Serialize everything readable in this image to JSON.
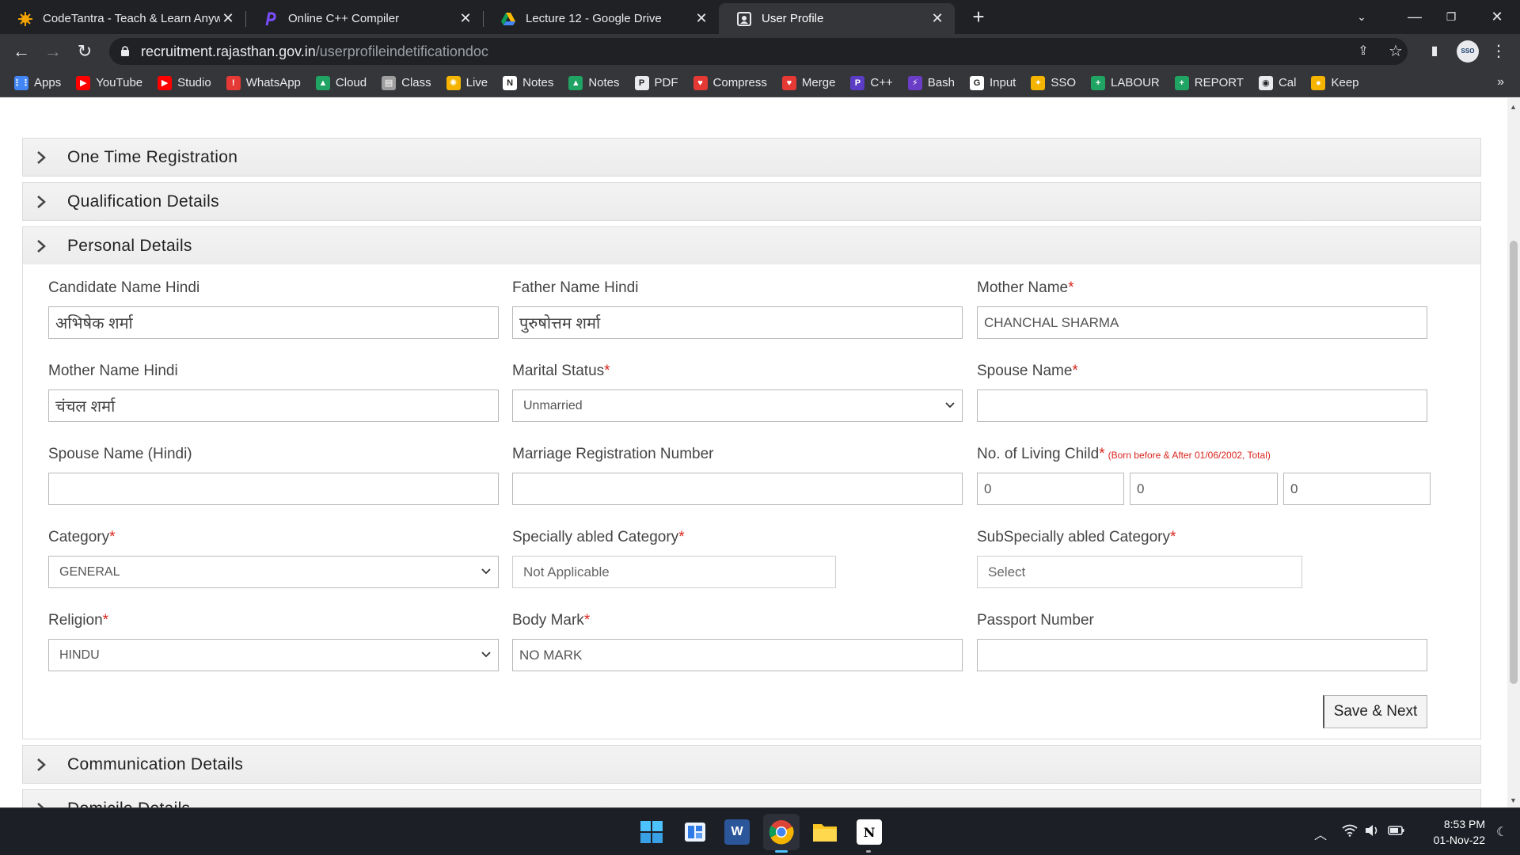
{
  "browser": {
    "tabs": [
      {
        "title": "CodeTantra - Teach & Learn Anyw",
        "icon": "codetantra-icon",
        "active": false
      },
      {
        "title": "Online C++ Compiler",
        "icon": "programiz-icon",
        "active": false
      },
      {
        "title": "Lecture 12 - Google Drive",
        "icon": "google-drive-icon",
        "active": false
      },
      {
        "title": "User Profile",
        "icon": "page-icon",
        "active": true
      }
    ],
    "url_host": "recruitment.rajasthan.gov.in",
    "url_path": "/userprofileindetificationdoc",
    "profile_badge": "SSO",
    "bookmarks": [
      {
        "label": "Apps",
        "icon": "apps-grid-icon",
        "color": "#4285f4"
      },
      {
        "label": "YouTube",
        "icon": "youtube-icon",
        "color": "#ff0000"
      },
      {
        "label": "Studio",
        "icon": "youtube-studio-icon",
        "color": "#ff0000"
      },
      {
        "label": "WhatsApp",
        "icon": "whatsapp-icon",
        "color": "#e53935"
      },
      {
        "label": "Cloud",
        "icon": "google-drive-icon",
        "color": "#1fa463"
      },
      {
        "label": "Class",
        "icon": "document-icon",
        "color": "#9e9e9e"
      },
      {
        "label": "Live",
        "icon": "codetantra-icon",
        "color": "#f4b400"
      },
      {
        "label": "Notes",
        "icon": "notion-icon",
        "color": "#ffffff"
      },
      {
        "label": "Notes",
        "icon": "google-drive-icon",
        "color": "#1fa463"
      },
      {
        "label": "PDF",
        "icon": "png-pdf-icon",
        "color": "#e8eaed"
      },
      {
        "label": "Compress",
        "icon": "heart-icon",
        "color": "#e53935"
      },
      {
        "label": "Merge",
        "icon": "heart-icon",
        "color": "#e53935"
      },
      {
        "label": "C++",
        "icon": "programiz-icon",
        "color": "#5b3cc4"
      },
      {
        "label": "Bash",
        "icon": "bolt-icon",
        "color": "#6a3dc6"
      },
      {
        "label": "Input",
        "icon": "google-icon",
        "color": "#ffffff"
      },
      {
        "label": "SSO",
        "icon": "emblem-icon",
        "color": "#f4b400"
      },
      {
        "label": "LABOUR",
        "icon": "plus-icon",
        "color": "#1fa463"
      },
      {
        "label": "REPORT",
        "icon": "plus-icon",
        "color": "#1fa463"
      },
      {
        "label": "Cal",
        "icon": "calendar-icon",
        "color": "#e8eaed"
      },
      {
        "label": "Keep",
        "icon": "keep-icon",
        "color": "#f4b400"
      }
    ]
  },
  "sections": {
    "one_time_registration": "One Time Registration",
    "qualification_details": "Qualification Details",
    "personal_details": "Personal Details",
    "communication_details": "Communication Details",
    "domicile_details": "Domicile Details"
  },
  "form": {
    "candidate_name_hindi": {
      "label": "Candidate Name Hindi",
      "value": "अभिषेक शर्मा"
    },
    "father_name_hindi": {
      "label": "Father Name Hindi",
      "value": "पुरुषोत्तम शर्मा"
    },
    "mother_name": {
      "label": "Mother Name",
      "value": "CHANCHAL SHARMA"
    },
    "mother_name_hindi": {
      "label": "Mother Name Hindi",
      "value": "चंचल शर्मा"
    },
    "marital_status": {
      "label": "Marital Status",
      "value": "Unmarried"
    },
    "spouse_name": {
      "label": "Spouse Name",
      "value": ""
    },
    "spouse_name_hindi": {
      "label": "Spouse Name (Hindi)",
      "value": ""
    },
    "marriage_registration_number": {
      "label": "Marriage Registration Number",
      "value": ""
    },
    "living_child": {
      "label": "No. of Living Child",
      "hint": "(Born before & After 01/06/2002, Total)",
      "before": "0",
      "after": "0",
      "total": "0"
    },
    "category": {
      "label": "Category",
      "value": "GENERAL"
    },
    "specially_abled_category": {
      "label": "Specially abled Category",
      "value": "Not Applicable"
    },
    "subspecially_abled_category": {
      "label": "SubSpecially abled Category",
      "value": "Select"
    },
    "religion": {
      "label": "Religion",
      "value": "HINDU"
    },
    "body_mark": {
      "label": "Body Mark",
      "value": "NO MARK"
    },
    "passport_number": {
      "label": "Passport Number",
      "value": ""
    },
    "required_mark": "*",
    "save_next_label": "Save & Next"
  },
  "taskbar": {
    "time": "8:53 PM",
    "date": "01-Nov-22"
  },
  "colors": {
    "required": "#d9251d",
    "accordion_bg": "#f0f0f0",
    "chrome_dark": "#202124"
  }
}
